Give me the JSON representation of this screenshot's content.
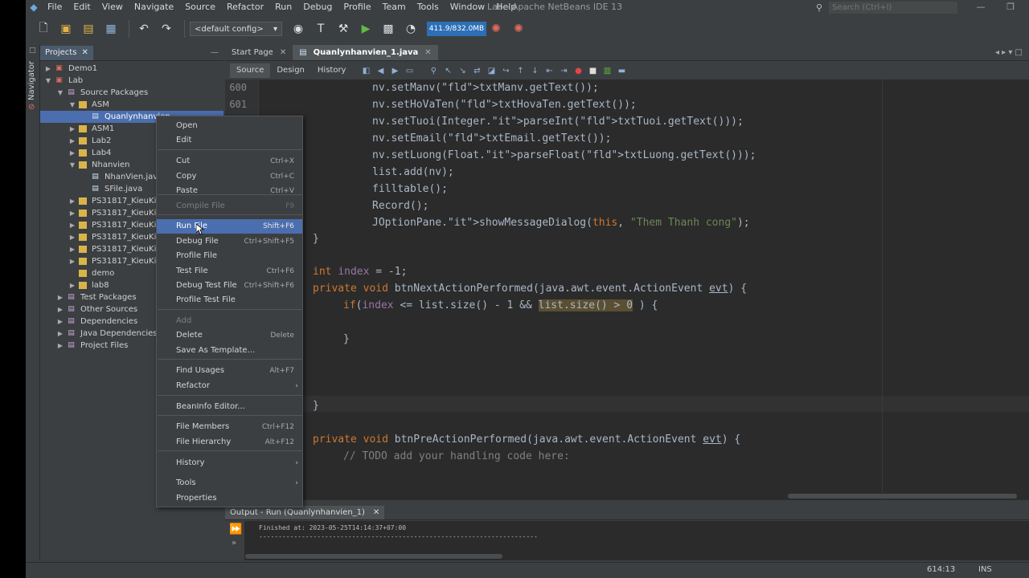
{
  "window": {
    "title": "Lab - Apache NetBeans IDE 13"
  },
  "menubar": {
    "items": [
      "File",
      "Edit",
      "View",
      "Navigate",
      "Source",
      "Refactor",
      "Run",
      "Debug",
      "Profile",
      "Team",
      "Tools",
      "Window",
      "Help"
    ]
  },
  "search": {
    "placeholder": "Search (Ctrl+I)"
  },
  "toolbar": {
    "config": "<default config>",
    "memory": "411.9/832.0MB"
  },
  "navigator": {
    "label": "Navigator"
  },
  "projects": {
    "tab_label": "Projects",
    "tree": [
      {
        "label": "Demo1",
        "type": "project",
        "level": 0,
        "toggle": "▶"
      },
      {
        "label": "Lab",
        "type": "project",
        "level": 0,
        "toggle": "▼"
      },
      {
        "label": "Source Packages",
        "type": "folder",
        "level": 1,
        "toggle": "▼"
      },
      {
        "label": "ASM",
        "type": "package",
        "level": 2,
        "toggle": "▼"
      },
      {
        "label": "Quanlynhanvien",
        "type": "java",
        "level": 3,
        "toggle": "",
        "selected": true
      },
      {
        "label": "ASM1",
        "type": "package",
        "level": 2,
        "toggle": "▶"
      },
      {
        "label": "Lab2",
        "type": "package",
        "level": 2,
        "toggle": "▶"
      },
      {
        "label": "Lab4",
        "type": "package",
        "level": 2,
        "toggle": "▶"
      },
      {
        "label": "Nhanvien",
        "type": "package",
        "level": 2,
        "toggle": "▼"
      },
      {
        "label": "NhanVien.java",
        "type": "java",
        "level": 3,
        "toggle": ""
      },
      {
        "label": "SFile.java",
        "type": "java",
        "level": 3,
        "toggle": ""
      },
      {
        "label": "PS31817_KieuKien",
        "type": "package",
        "level": 2,
        "toggle": "▶"
      },
      {
        "label": "PS31817_KieuKien",
        "type": "package",
        "level": 2,
        "toggle": "▶"
      },
      {
        "label": "PS31817_KieuKien",
        "type": "package",
        "level": 2,
        "toggle": "▶"
      },
      {
        "label": "PS31817_KieuKien",
        "type": "package",
        "level": 2,
        "toggle": "▶"
      },
      {
        "label": "PS31817_KieuKien",
        "type": "package",
        "level": 2,
        "toggle": "▶"
      },
      {
        "label": "PS31817_KieuKien",
        "type": "package",
        "level": 2,
        "toggle": "▶"
      },
      {
        "label": "demo",
        "type": "package",
        "level": 2,
        "toggle": ""
      },
      {
        "label": "lab8",
        "type": "package",
        "level": 2,
        "toggle": "▶"
      },
      {
        "label": "Test Packages",
        "type": "folder",
        "level": 1,
        "toggle": "▶"
      },
      {
        "label": "Other Sources",
        "type": "folder",
        "level": 1,
        "toggle": "▶"
      },
      {
        "label": "Dependencies",
        "type": "folder",
        "level": 1,
        "toggle": "▶"
      },
      {
        "label": "Java Dependencies",
        "type": "folder",
        "level": 1,
        "toggle": "▶"
      },
      {
        "label": "Project Files",
        "type": "folder",
        "level": 1,
        "toggle": "▶"
      }
    ]
  },
  "editor": {
    "tabs": [
      {
        "label": "Start Page",
        "active": false
      },
      {
        "label": "Quanlynhanvien_1.java",
        "active": true
      }
    ],
    "modes": [
      "Source",
      "Design",
      "History"
    ],
    "line_numbers": [
      "600",
      "601"
    ],
    "lines": [
      "nv.setManv(txtManv.getText());",
      "nv.setHoVaTen(txtHovaTen.getText());",
      "nv.setTuoi(Integer.parseInt(txtTuoi.getText()));",
      "nv.setEmail(txtEmail.getText());",
      "nv.setLuong(Float.parseFloat(txtLuong.getText()));",
      "list.add(nv);",
      "filltable();",
      "Record();",
      "JOptionPane.showMessageDialog(this, \"Them Thanh cong\");",
      "}",
      "int index = -1;",
      "private void btnNextActionPerformed(java.awt.event.ActionEvent evt) {",
      "if(index <= list.size() - 1 && list.size() > 0 ) {",
      "}",
      "}",
      "private void btnPreActionPerformed(java.awt.event.ActionEvent evt) {",
      "// TODO add your handling code here:"
    ]
  },
  "context_menu": {
    "items": [
      {
        "label": "Open",
        "shortcut": ""
      },
      {
        "label": "Edit",
        "shortcut": ""
      },
      {
        "label": "Cut",
        "shortcut": "Ctrl+X"
      },
      {
        "label": "Copy",
        "shortcut": "Ctrl+C"
      },
      {
        "label": "Paste",
        "shortcut": "Ctrl+V"
      },
      {
        "label": "Compile File",
        "shortcut": "F9",
        "disabled": true
      },
      {
        "label": "Run File",
        "shortcut": "Shift+F6",
        "highlighted": true
      },
      {
        "label": "Debug File",
        "shortcut": "Ctrl+Shift+F5"
      },
      {
        "label": "Profile File",
        "shortcut": ""
      },
      {
        "label": "Test File",
        "shortcut": "Ctrl+F6"
      },
      {
        "label": "Debug Test File",
        "shortcut": "Ctrl+Shift+F6"
      },
      {
        "label": "Profile Test File",
        "shortcut": ""
      },
      {
        "label": "Add",
        "shortcut": "",
        "disabled": true
      },
      {
        "label": "Delete",
        "shortcut": "Delete"
      },
      {
        "label": "Save As Template...",
        "shortcut": ""
      },
      {
        "label": "Find Usages",
        "shortcut": "Alt+F7"
      },
      {
        "label": "Refactor",
        "shortcut": "",
        "submenu": true
      },
      {
        "label": "BeanInfo Editor...",
        "shortcut": ""
      },
      {
        "label": "File Members",
        "shortcut": "Ctrl+F12"
      },
      {
        "label": "File Hierarchy",
        "shortcut": "Alt+F12"
      },
      {
        "label": "History",
        "shortcut": "",
        "submenu": true
      },
      {
        "label": "Tools",
        "shortcut": "",
        "submenu": true
      },
      {
        "label": "Properties",
        "shortcut": ""
      }
    ]
  },
  "output": {
    "tab_label": "Output - Run (Quanlynhanvien_1)",
    "lines": [
      "Finished at: 2023-05-25T14:14:37+07:00",
      "------------------------------------------------------------------------"
    ]
  },
  "status": {
    "caret": "614:13",
    "mode": "INS"
  }
}
